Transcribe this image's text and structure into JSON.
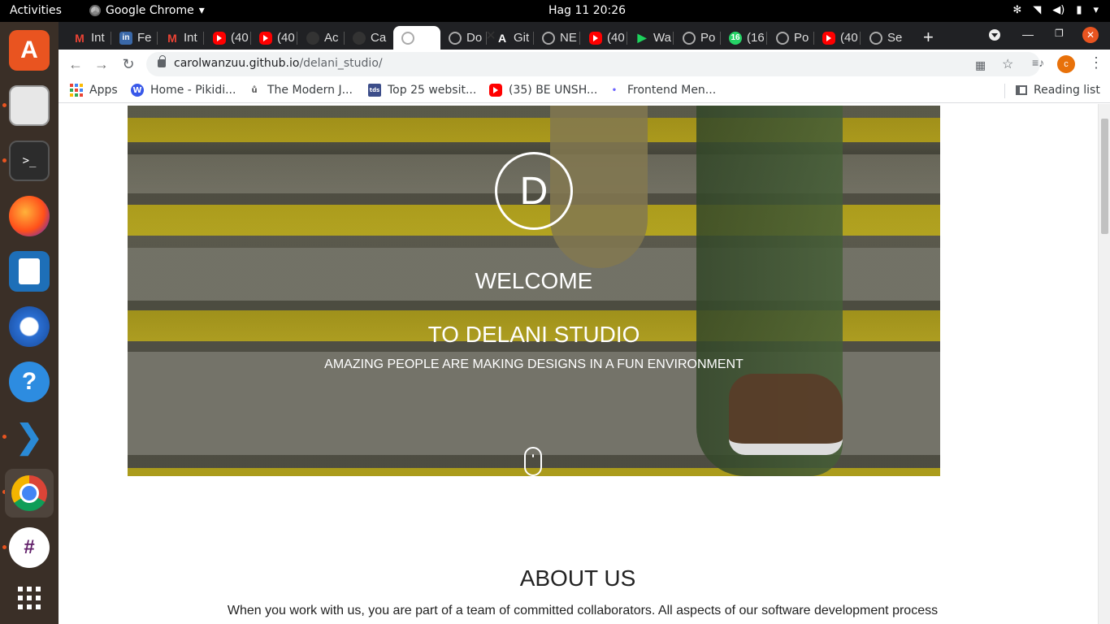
{
  "topbar": {
    "activities": "Activities",
    "app_name": "Google Chrome",
    "clock": "Hag 11  20:26"
  },
  "tabs": [
    {
      "label": "Int",
      "icon": "gmail-icon"
    },
    {
      "label": "Fe",
      "icon": "linkedin-icon"
    },
    {
      "label": "Int",
      "icon": "gmail-icon"
    },
    {
      "label": "(40",
      "icon": "youtube-icon"
    },
    {
      "label": "(40",
      "icon": "youtube-icon"
    },
    {
      "label": "Ac",
      "icon": "github-icon"
    },
    {
      "label": "Ca",
      "icon": "github-icon"
    },
    {
      "label": "",
      "icon": "globe-icon",
      "active": true
    },
    {
      "label": "Do",
      "icon": "globe-icon"
    },
    {
      "label": "Git",
      "icon": "angular-icon"
    },
    {
      "label": "NE",
      "icon": "globe-icon"
    },
    {
      "label": "(40",
      "icon": "youtube-icon"
    },
    {
      "label": "Wa",
      "icon": "play-icon"
    },
    {
      "label": "Po",
      "icon": "globe-icon"
    },
    {
      "label": "(16",
      "icon": "whatsapp-icon"
    },
    {
      "label": "Po",
      "icon": "globe-icon"
    },
    {
      "label": "(40",
      "icon": "youtube-icon"
    },
    {
      "label": "Se",
      "icon": "globe-icon"
    }
  ],
  "omnibox": {
    "host": "carolwanzuu.github.io",
    "path": "/delani_studio/"
  },
  "profile_initial": "c",
  "bookmarks": [
    {
      "label": "Apps",
      "icon": "apps-grid-icon"
    },
    {
      "label": "Home - Pikidi...",
      "icon": "wordpress-icon"
    },
    {
      "label": "The Modern J...",
      "icon": "modern-js-icon"
    },
    {
      "label": "Top 25 websit...",
      "icon": "tds-icon"
    },
    {
      "label": "(35) BE UNSH...",
      "icon": "youtube-icon"
    },
    {
      "label": "Frontend Men...",
      "icon": "frontend-mentor-icon"
    }
  ],
  "reading_list": "Reading list",
  "hero": {
    "logo_letter": "D",
    "welcome": "WELCOME",
    "title": "TO DELANI STUDIO",
    "tagline": "AMAZING PEOPLE ARE MAKING DESIGNS IN A FUN ENVIRONMENT"
  },
  "about": {
    "title": "ABOUT US",
    "text": "When you work with us, you are part of a team of committed collaborators. All aspects of our software development process"
  },
  "colors": {
    "ubuntu_orange": "#e95420",
    "chrome_dark": "#202124",
    "stair_yellow": "#d6bf1c"
  }
}
